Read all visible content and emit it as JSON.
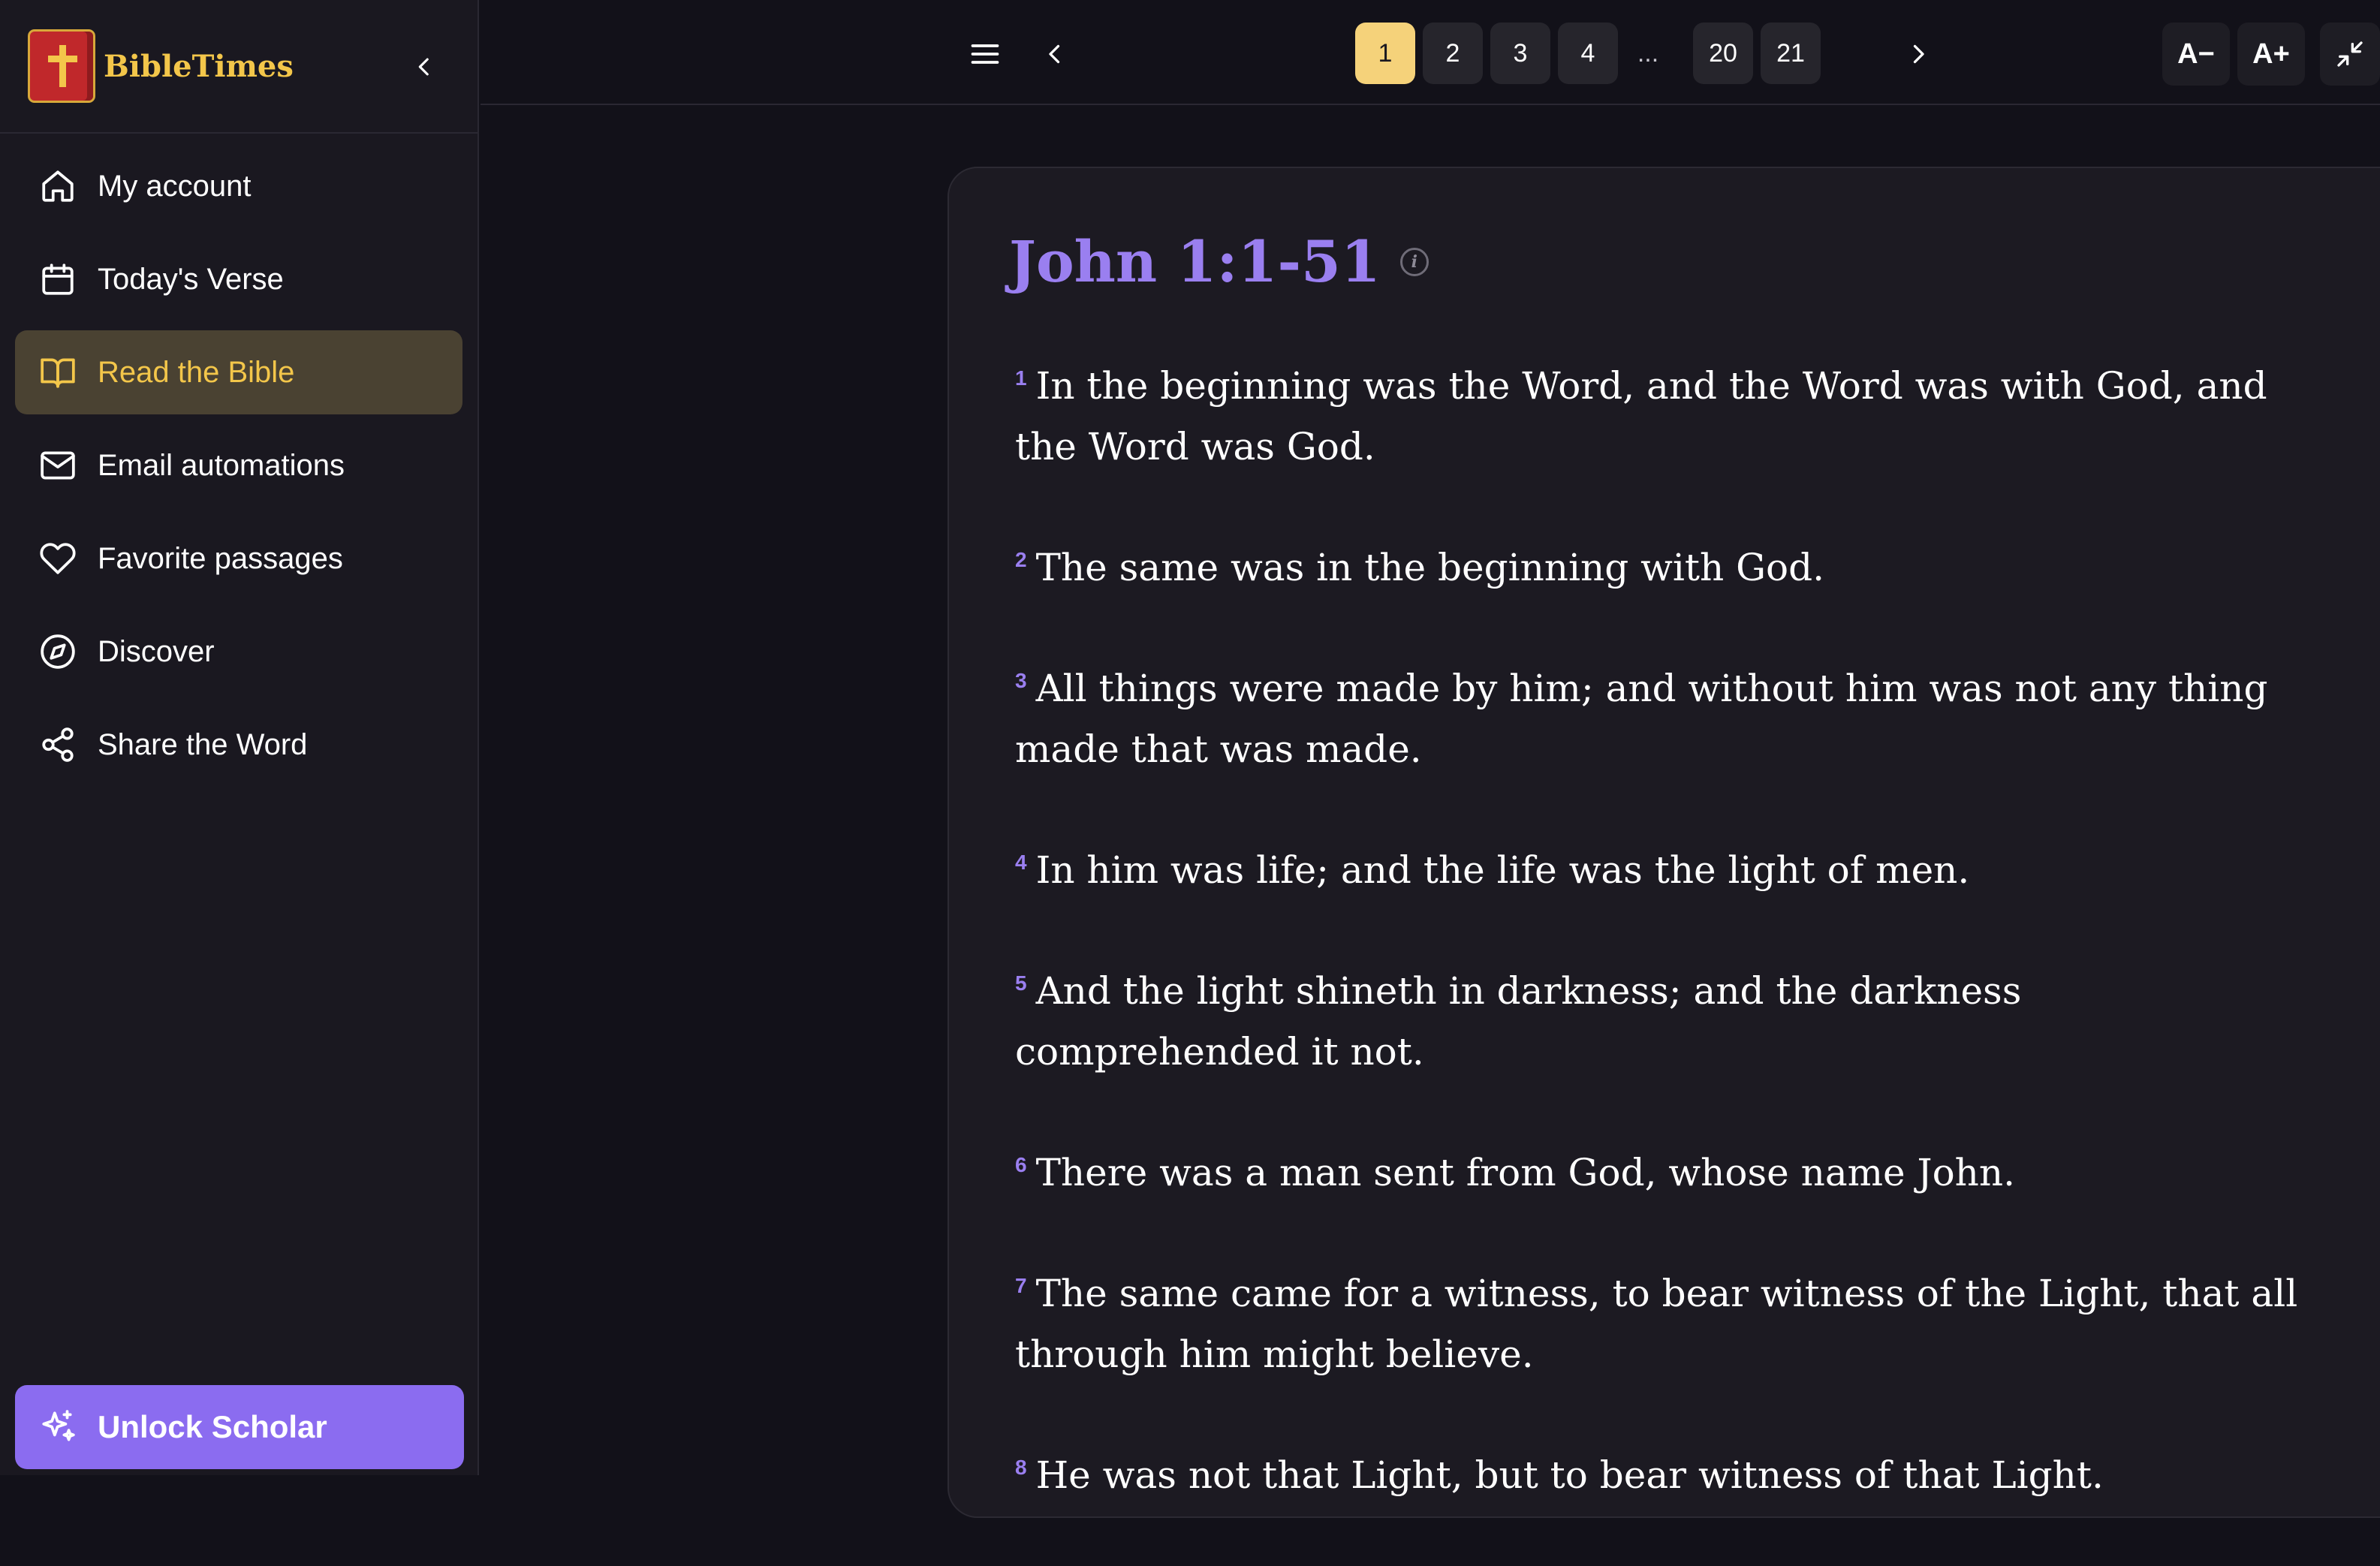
{
  "brand": {
    "name": "BibleTimes"
  },
  "sidebar": {
    "items": [
      {
        "label": "My account",
        "icon": "home-icon"
      },
      {
        "label": "Today's Verse",
        "icon": "calendar-icon"
      },
      {
        "label": "Read the Bible",
        "icon": "book-open-icon",
        "active": true
      },
      {
        "label": "Email automations",
        "icon": "mail-icon"
      },
      {
        "label": "Favorite passages",
        "icon": "heart-icon"
      },
      {
        "label": "Discover",
        "icon": "compass-icon"
      },
      {
        "label": "Share the Word",
        "icon": "share-icon"
      }
    ],
    "unlock_label": "Unlock Scholar"
  },
  "pagination": {
    "pages": [
      "1",
      "2",
      "3",
      "4",
      "20",
      "21"
    ],
    "active": "1",
    "ellipsis": "..."
  },
  "font_controls": {
    "decrease": "A−",
    "increase": "A+"
  },
  "passage": {
    "title": "John 1:1-51",
    "info_glyph": "i",
    "verses": [
      {
        "num": "1",
        "text": "In the beginning was the Word, and the Word was with God, and the Word was God."
      },
      {
        "num": "2",
        "text": "The same was in the beginning with God."
      },
      {
        "num": "3",
        "text": "All things were made by him; and without him was not any thing made that was made."
      },
      {
        "num": "4",
        "text": "In him was life; and the life was the light of men."
      },
      {
        "num": "5",
        "text": "And the light shineth in darkness; and the darkness comprehended it not."
      },
      {
        "num": "6",
        "text": "There was a man sent from God, whose name John."
      },
      {
        "num": "7",
        "text": "The same came for a witness, to bear witness of the Light, that all through him might believe."
      },
      {
        "num": "8",
        "text": "He was not that Light, but to bear witness of that Light."
      }
    ]
  },
  "colors": {
    "accent_gold": "#f3c64a",
    "accent_purple": "#9a7ff0",
    "background": "#121119"
  }
}
